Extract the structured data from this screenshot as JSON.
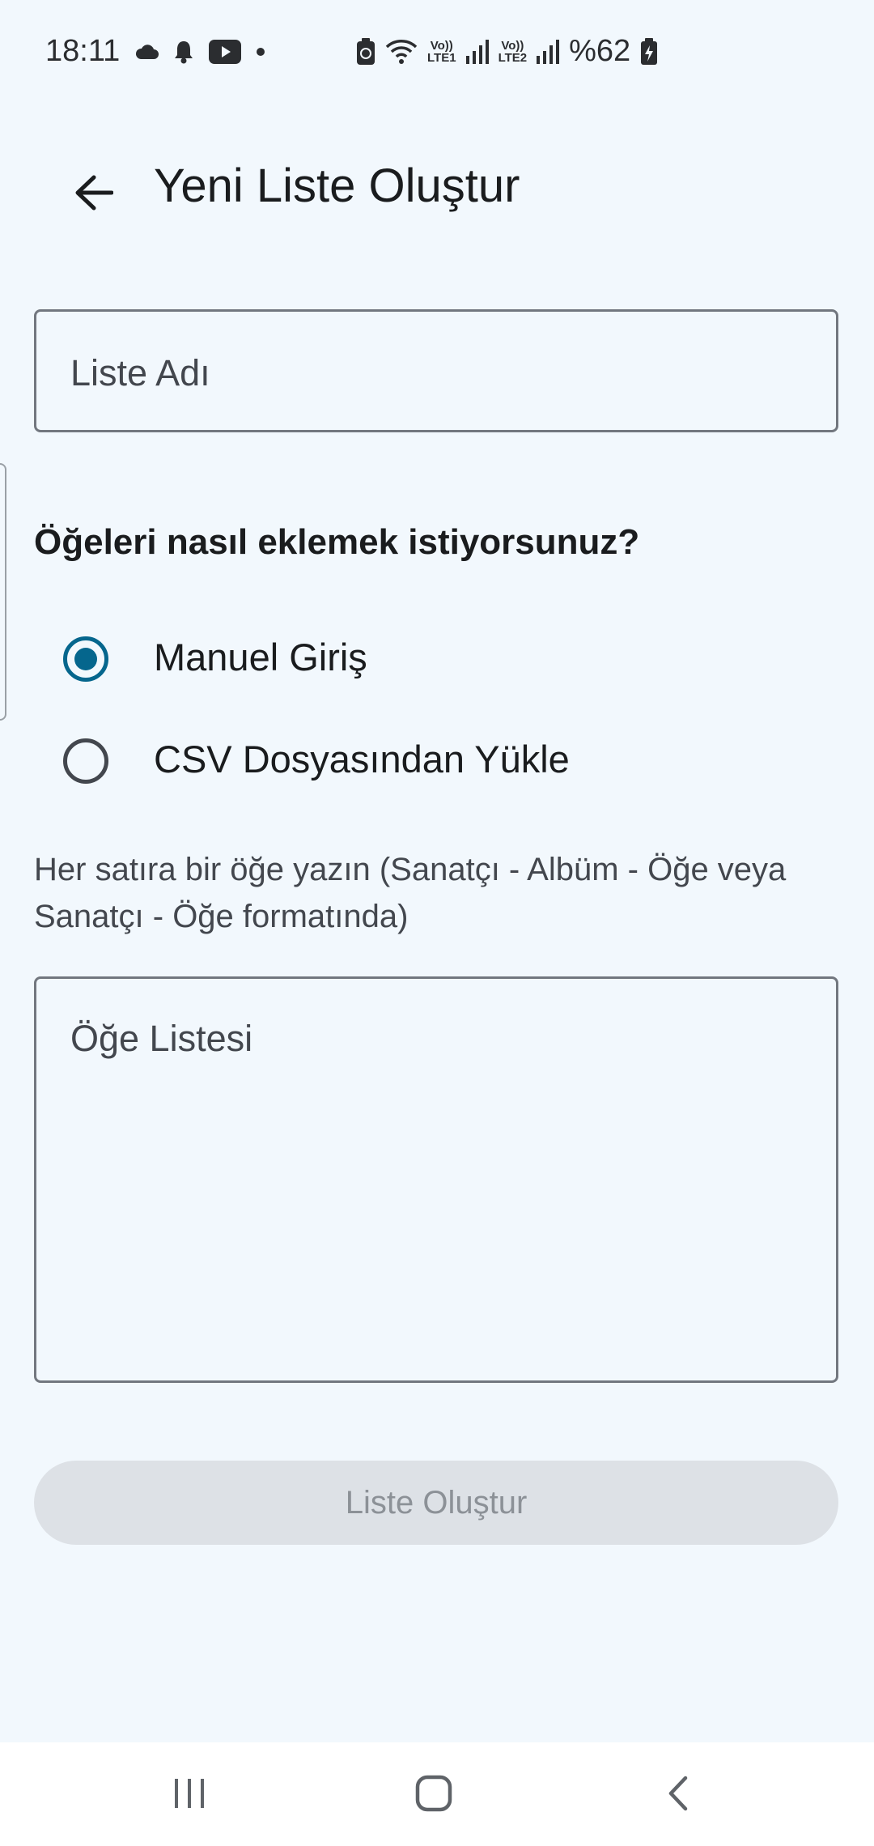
{
  "status_bar": {
    "time": "18:11",
    "icons_left": [
      "cloud-icon",
      "bell-icon",
      "youtube-icon",
      "dot-icon"
    ],
    "icons_right": [
      "recycle-battery-icon",
      "wifi-icon",
      "volte-lte1-icon",
      "signal-icon",
      "volte-lte2-icon",
      "signal-icon",
      "battery-charging-icon"
    ],
    "lte1_top": "Vo))",
    "lte1_bottom": "LTE1",
    "lte2_top": "Vo))",
    "lte2_bottom": "LTE2",
    "battery": "%62"
  },
  "app_bar": {
    "back_icon": "arrow-back-icon",
    "title": "Yeni Liste Oluştur"
  },
  "form": {
    "list_name_placeholder": "Liste Adı",
    "question": "Öğeleri nasıl eklemek istiyorsunuz?",
    "options": [
      {
        "label": "Manuel Giriş",
        "selected": true
      },
      {
        "label": "CSV Dosyasından Yükle",
        "selected": false
      }
    ],
    "helper_text": "Her satıra bir öğe yazın (Sanatçı - Albüm - Öğe veya Sanatçı - Öğe formatında)",
    "items_placeholder": "Öğe Listesi",
    "submit_label": "Liste Oluştur"
  },
  "colors": {
    "background": "#f2f8fd",
    "accent": "#05668d",
    "button_disabled_bg": "#dde1e6",
    "button_disabled_text": "#8c9197"
  },
  "nav_bar": {
    "items": [
      "recents-icon",
      "home-icon",
      "back-icon"
    ]
  }
}
